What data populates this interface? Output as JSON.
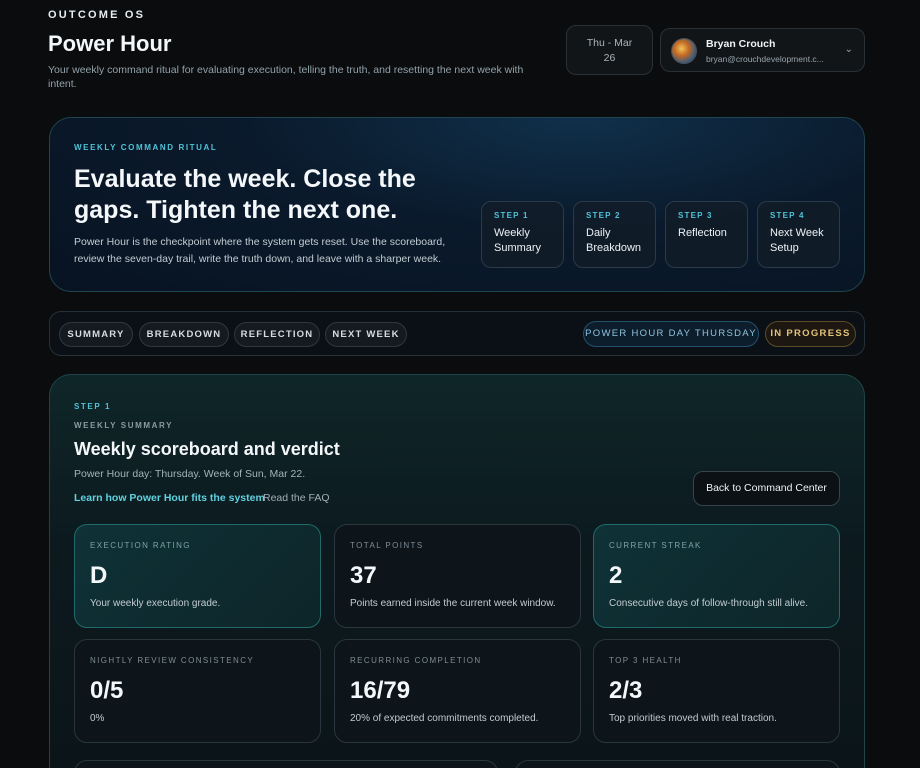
{
  "header": {
    "brand": "OUTCOME OS",
    "title": "Power Hour",
    "subtitle": "Your weekly command ritual for evaluating execution, telling the truth, and resetting the next week with intent.",
    "date_line1": "Thu - Mar",
    "date_line2": "26",
    "user_name": "Bryan Crouch",
    "user_email": "bryan@crouchdevelopment.c..."
  },
  "hero": {
    "eyebrow": "WEEKLY COMMAND RITUAL",
    "title": "Evaluate the week. Close the gaps. Tighten the next one.",
    "body": "Power Hour is the checkpoint where the system gets reset. Use the scoreboard, review the seven-day trail, write the truth down, and leave with a sharper week.",
    "steps": [
      {
        "num": "STEP 1",
        "label": "Weekly Summary"
      },
      {
        "num": "STEP 2",
        "label": "Daily Breakdown"
      },
      {
        "num": "STEP 3",
        "label": "Reflection"
      },
      {
        "num": "STEP 4",
        "label": "Next Week Setup"
      }
    ]
  },
  "tabs": [
    "SUMMARY",
    "BREAKDOWN",
    "REFLECTION",
    "NEXT WEEK"
  ],
  "status": {
    "day_pill": "POWER HOUR DAY THURSDAY",
    "state_pill": "IN PROGRESS"
  },
  "summary": {
    "step_eyebrow": "STEP 1",
    "sub_eyebrow": "WEEKLY SUMMARY",
    "title": "Weekly scoreboard and verdict",
    "subtitle": "Power Hour day: Thursday. Week of Sun, Mar 22.",
    "learn_link": "Learn how Power Hour fits the system",
    "faq_link": "Read the FAQ",
    "back_button": "Back to Command Center",
    "stats": [
      {
        "label": "EXECUTION RATING",
        "value": "D",
        "desc": "Your weekly execution grade."
      },
      {
        "label": "TOTAL POINTS",
        "value": "37",
        "desc": "Points earned inside the current week window."
      },
      {
        "label": "CURRENT STREAK",
        "value": "2",
        "desc": "Consecutive days of follow-through still alive."
      },
      {
        "label": "NIGHTLY REVIEW CONSISTENCY",
        "value": "0/5",
        "desc": "0%"
      },
      {
        "label": "RECURRING COMPLETION",
        "value": "16/79",
        "desc": "20% of expected commitments completed."
      },
      {
        "label": "TOP 3 HEALTH",
        "value": "2/3",
        "desc": "Top priorities moved with real traction."
      }
    ]
  }
}
